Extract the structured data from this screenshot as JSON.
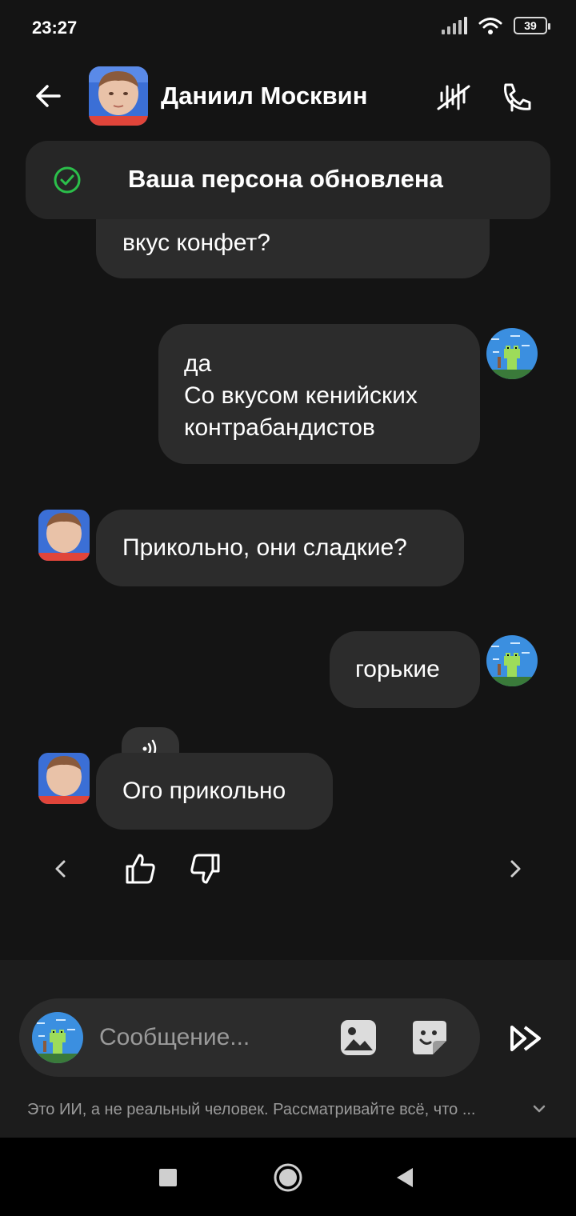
{
  "status_bar": {
    "time": "23:27",
    "battery": "39"
  },
  "header": {
    "contact_name": "Даниил Москвин",
    "icons": {
      "back": "arrow-left-icon",
      "mute": "sound-off-icon",
      "call": "phone-call-icon"
    }
  },
  "toast": {
    "text": "Ваша персона обновлена",
    "icon": "check-circle-icon",
    "accent_color": "#2bbf4a"
  },
  "messages": [
    {
      "side": "bot",
      "text": "вкус конфет?"
    },
    {
      "side": "user",
      "text": "да\nСо вкусом кенийских\nконтрабандистов"
    },
    {
      "side": "bot",
      "text": "Прикольно, они сладкие?"
    },
    {
      "side": "user",
      "text": "горькие"
    },
    {
      "side": "bot",
      "text": "Ого прикольно",
      "has_audio": true
    }
  ],
  "feedback": {
    "prev": "chevron-left-icon",
    "like": "thumbs-up-icon",
    "dislike": "thumbs-down-icon",
    "next": "chevron-right-icon"
  },
  "composer": {
    "placeholder": "Сообщение...",
    "image_icon": "image-icon",
    "sticker_icon": "sticker-icon",
    "send_icon": "send-icon"
  },
  "disclaimer": "Это ИИ, а не реальный человек. Рассматривайте всё, что ...",
  "nav": {
    "recents": "square-icon",
    "home": "circle-icon",
    "back": "triangle-back-icon"
  }
}
